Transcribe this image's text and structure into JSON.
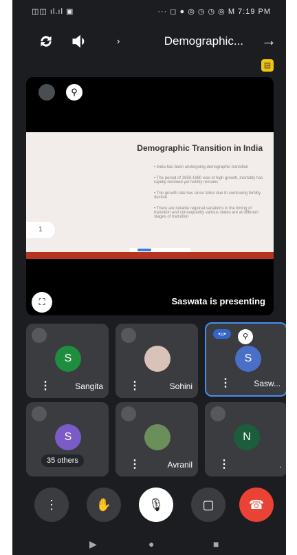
{
  "status": {
    "left": "◫◫ ıl.ıl ▣",
    "right": "··· ◻ ● ◎ ◷ ◷ ◎ M 7:19 PM"
  },
  "appbar": {
    "title": "Demographic...",
    "chevron": "›",
    "back_arrow": "→"
  },
  "stage": {
    "slide_title": "Demographic Transition in India",
    "bullets": [
      "• India has been undergoing demographic transition",
      "• The period of 1950-1980 was of high growth, mortality has rapidly declined yet fertility remains",
      "• The growth rate has since fallen due to continuing fertility decline",
      "• There are notable regional variations in the timing of transition and consequently various states are at different stages of transition"
    ],
    "page_indicator": "1",
    "presenting_text": "Saswata is presenting"
  },
  "participants": [
    {
      "name": "Sangita",
      "initial": "S",
      "color": "#1e8e3e"
    },
    {
      "name": "Sohini",
      "initial": "",
      "color": "#d9c3b8"
    },
    {
      "name": "Sasw...",
      "initial": "S",
      "color": "#4a6fc9"
    },
    {
      "name": "35 others",
      "initial": "S",
      "color": "#7b5cc7"
    },
    {
      "name": "Avranil",
      "initial": "",
      "color": "#6b8f5a"
    },
    {
      "name": ".",
      "initial": "N",
      "color": "#1b5e3b"
    }
  ],
  "colors": {
    "accent": "#4a8cf0",
    "end_call": "#ea4335"
  }
}
